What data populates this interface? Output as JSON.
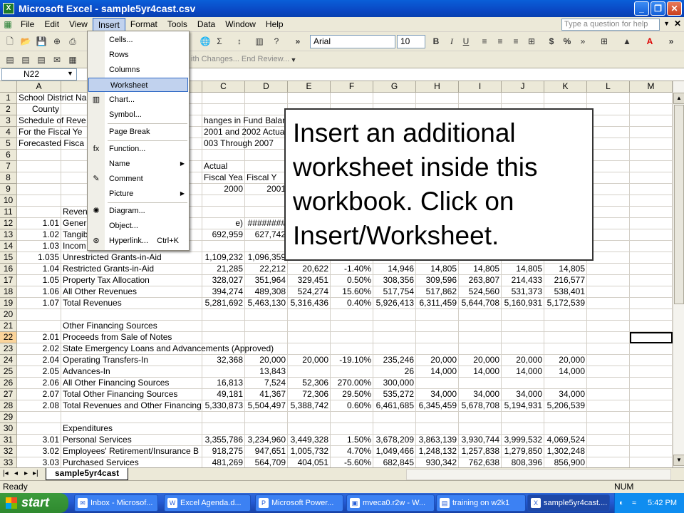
{
  "window": {
    "title": "Microsoft Excel - sample5yr4cast.csv"
  },
  "menubar": {
    "items": [
      "File",
      "Edit",
      "View",
      "Insert",
      "Format",
      "Tools",
      "Data",
      "Window",
      "Help"
    ],
    "help_placeholder": "Type a question for help"
  },
  "toolbar": {
    "font": "Arial",
    "size": "10",
    "review_text": "ith Changes...   End Review..."
  },
  "namebox": "N22",
  "columns": [
    "A",
    "B",
    "C",
    "D",
    "E",
    "F",
    "G",
    "H",
    "I",
    "J",
    "K",
    "L",
    "M"
  ],
  "rows": [
    {
      "n": "1",
      "cells": [
        "School District Na",
        "",
        "",
        "",
        "",
        "",
        "",
        "",
        "",
        "",
        ""
      ]
    },
    {
      "n": "2",
      "cells": [
        "County",
        "",
        "",
        "",
        "",
        "",
        "",
        "",
        "",
        "",
        ""
      ]
    },
    {
      "n": "3",
      "cells": [
        "Schedule of Reve",
        "",
        "hanges in Fund Balances",
        "",
        "",
        "",
        "",
        "",
        "",
        "",
        ""
      ]
    },
    {
      "n": "4",
      "cells": [
        "For the Fiscal Ye",
        "",
        "2001 and 2002 Actual;",
        "",
        "",
        "",
        "",
        "",
        "",
        "",
        ""
      ]
    },
    {
      "n": "5",
      "cells": [
        "Forecasted Fisca",
        "",
        "003 Through 2007",
        "",
        "",
        "",
        "",
        "",
        "",
        "",
        ""
      ]
    },
    {
      "n": "6",
      "cells": [
        "",
        "",
        "",
        "",
        "",
        "",
        "",
        "",
        "",
        "",
        ""
      ]
    },
    {
      "n": "7",
      "cells": [
        "",
        "",
        "Actual",
        "",
        "",
        "",
        "",
        "",
        "",
        "",
        ""
      ]
    },
    {
      "n": "8",
      "cells": [
        "",
        "",
        "Fiscal Yea",
        "Fiscal Y",
        "",
        "",
        "",
        "",
        "",
        "",
        ""
      ]
    },
    {
      "n": "9",
      "cells": [
        "",
        "",
        "2000",
        "2001",
        "",
        "",
        "",
        "",
        "",
        "",
        ""
      ]
    },
    {
      "n": "10",
      "cells": [
        "",
        "",
        "",
        "",
        "",
        "",
        "",
        "",
        "",
        "",
        ""
      ]
    },
    {
      "n": "11",
      "cells": [
        "",
        "Reven",
        "",
        "",
        "",
        "",
        "",
        "",
        "",
        "",
        ""
      ]
    },
    {
      "n": "12",
      "cells": [
        "1.01",
        "Gener",
        "e)",
        "########",
        "#########",
        "",
        "",
        "",
        "",
        "",
        ""
      ]
    },
    {
      "n": "13",
      "cells": [
        "1.02",
        "Tangib",
        "",
        "692,959",
        "627,742",
        "",
        "",
        "",
        "",
        "",
        ""
      ]
    },
    {
      "n": "14",
      "cells": [
        "1.03",
        "Incom",
        "",
        "",
        "",
        "",
        "",
        "",
        "",
        "",
        ""
      ]
    },
    {
      "n": "15",
      "cells": [
        "1.035",
        "Unrestricted Grants-in-Aid",
        "",
        "1,109,232",
        "1,096,359",
        "",
        "",
        "",
        "",
        "",
        ""
      ]
    },
    {
      "n": "16",
      "cells": [
        "1.04",
        "Restricted Grants-in-Aid",
        "",
        "21,285",
        "22,212",
        "20,622",
        "-1.40%",
        "14,946",
        "14,805",
        "14,805",
        "14,805",
        "14,805"
      ]
    },
    {
      "n": "17",
      "cells": [
        "1.05",
        "Property Tax Allocation",
        "",
        "328,027",
        "351,964",
        "329,451",
        "0.50%",
        "308,356",
        "309,596",
        "263,807",
        "214,433",
        "216,577"
      ]
    },
    {
      "n": "18",
      "cells": [
        "1.06",
        "All Other Revenues",
        "",
        "394,274",
        "489,308",
        "524,274",
        "15.60%",
        "517,754",
        "517,862",
        "524,560",
        "531,373",
        "538,401"
      ]
    },
    {
      "n": "19",
      "cells": [
        "1.07",
        "Total Revenues",
        "",
        "5,281,692",
        "5,463,130",
        "5,316,436",
        "0.40%",
        "5,926,413",
        "6,311,459",
        "5,644,708",
        "5,160,931",
        "5,172,539"
      ]
    },
    {
      "n": "20",
      "cells": [
        "",
        "",
        "",
        "",
        "",
        "",
        "",
        "",
        "",
        "",
        ""
      ]
    },
    {
      "n": "21",
      "cells": [
        "",
        "Other Financing Sources",
        "",
        "",
        "",
        "",
        "",
        "",
        "",
        "",
        ""
      ]
    },
    {
      "n": "22",
      "cells": [
        "2.01",
        "Proceeds from Sale of Notes",
        "",
        "",
        "",
        "",
        "",
        "",
        "",
        "",
        ""
      ]
    },
    {
      "n": "23",
      "cells": [
        "2.02",
        "State Emergency Loans and Advancements (Approved)",
        "",
        "",
        "",
        "",
        "",
        "",
        "",
        "",
        ""
      ]
    },
    {
      "n": "24",
      "cells": [
        "2.04",
        "Operating Transfers-In",
        "",
        "32,368",
        "20,000",
        "20,000",
        "-19.10%",
        "235,246",
        "20,000",
        "20,000",
        "20,000",
        "20,000"
      ]
    },
    {
      "n": "25",
      "cells": [
        "2.05",
        "Advances-In",
        "",
        "",
        "13,843",
        "",
        "",
        "26",
        "14,000",
        "14,000",
        "14,000",
        "14,000"
      ]
    },
    {
      "n": "26",
      "cells": [
        "2.06",
        "All Other Financing Sources",
        "",
        "16,813",
        "7,524",
        "52,306",
        "270.00%",
        "300,000",
        "",
        "",
        "",
        ""
      ]
    },
    {
      "n": "27",
      "cells": [
        "2.07",
        "Total Other Financing Sources",
        "",
        "49,181",
        "41,367",
        "72,306",
        "29.50%",
        "535,272",
        "34,000",
        "34,000",
        "34,000",
        "34,000"
      ]
    },
    {
      "n": "28",
      "cells": [
        "2.08",
        "Total Revenues and Other Financing",
        "",
        "5,330,873",
        "5,504,497",
        "5,388,742",
        "0.60%",
        "6,461,685",
        "6,345,459",
        "5,678,708",
        "5,194,931",
        "5,206,539"
      ]
    },
    {
      "n": "29",
      "cells": [
        "",
        "",
        "",
        "",
        "",
        "",
        "",
        "",
        "",
        "",
        ""
      ]
    },
    {
      "n": "30",
      "cells": [
        "",
        "Expenditures",
        "",
        "",
        "",
        "",
        "",
        "",
        "",
        "",
        ""
      ]
    },
    {
      "n": "31",
      "cells": [
        "3.01",
        "Personal Services",
        "",
        "3,355,786",
        "3,234,960",
        "3,449,328",
        "1.50%",
        "3,678,209",
        "3,863,139",
        "3,930,744",
        "3,999,532",
        "4,069,524"
      ]
    },
    {
      "n": "32",
      "cells": [
        "3.02",
        "Employees' Retirement/Insurance B",
        "",
        "918,275",
        "947,651",
        "1,005,732",
        "4.70%",
        "1,049,466",
        "1,248,132",
        "1,257,838",
        "1,279,850",
        "1,302,248"
      ]
    },
    {
      "n": "33",
      "cells": [
        "3.03",
        "Purchased Services",
        "",
        "481,269",
        "564,709",
        "404,051",
        "-5.60%",
        "682,845",
        "930,342",
        "762,638",
        "808,396",
        "856,900"
      ]
    }
  ],
  "insert_menu": [
    {
      "label": "Cells...",
      "icon": ""
    },
    {
      "label": "Rows",
      "icon": ""
    },
    {
      "label": "Columns",
      "icon": ""
    },
    {
      "label": "Worksheet",
      "icon": "",
      "highlight": true
    },
    {
      "label": "Chart...",
      "icon": "chart"
    },
    {
      "label": "Symbol...",
      "icon": ""
    },
    {
      "label": "Page Break",
      "icon": ""
    },
    {
      "label": "Function...",
      "icon": "fx"
    },
    {
      "label": "Name",
      "icon": "",
      "arrow": true
    },
    {
      "label": "Comment",
      "icon": "comment"
    },
    {
      "label": "Picture",
      "icon": "",
      "arrow": true
    },
    {
      "label": "Diagram...",
      "icon": "diagram"
    },
    {
      "label": "Object...",
      "icon": ""
    },
    {
      "label": "Hyperlink...",
      "icon": "link",
      "shortcut": "Ctrl+K"
    }
  ],
  "sheet_tab": "sample5yr4cast",
  "status": {
    "left": "Ready",
    "num": "NUM"
  },
  "taskbar": {
    "start": "start",
    "tasks": [
      "Inbox - Microsof...",
      "Excel Agenda.d...",
      "Microsoft Power...",
      "mveca0.r2w - W...",
      "training on w2k1",
      "sample5yr4cast...."
    ],
    "clock": "5:42 PM"
  },
  "callout": "Insert an additional worksheet inside this workbook.  Click on Insert/Worksheet."
}
